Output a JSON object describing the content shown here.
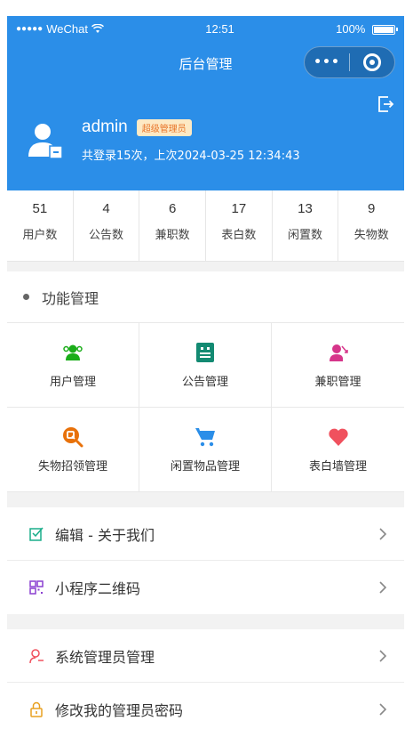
{
  "status_bar": {
    "carrier": "WeChat",
    "time": "12:51",
    "battery": "100%"
  },
  "nav": {
    "title": "后台管理",
    "more_icon": "more-dots-icon",
    "close_icon": "circle-target-icon"
  },
  "profile": {
    "username": "admin",
    "role": "超级管理员",
    "login_info": "共登录15次，上次2024-03-25 12:34:43"
  },
  "stats": [
    {
      "value": "51",
      "label": "用户数"
    },
    {
      "value": "4",
      "label": "公告数"
    },
    {
      "value": "6",
      "label": "兼职数"
    },
    {
      "value": "17",
      "label": "表白数"
    },
    {
      "value": "13",
      "label": "闲置数"
    },
    {
      "value": "9",
      "label": "失物数"
    }
  ],
  "functions": {
    "title": "功能管理",
    "items": [
      {
        "label": "用户管理",
        "icon": "users-icon",
        "color": "#1aad19"
      },
      {
        "label": "公告管理",
        "icon": "notice-icon",
        "color": "#138a72"
      },
      {
        "label": "兼职管理",
        "icon": "part-time-icon",
        "color": "#d6358a"
      },
      {
        "label": "失物招领管理",
        "icon": "lost-found-icon",
        "color": "#e8710a"
      },
      {
        "label": "闲置物品管理",
        "icon": "cart-icon",
        "color": "#2b8ee8"
      },
      {
        "label": "表白墙管理",
        "icon": "heart-icon",
        "color": "#f0515e"
      }
    ]
  },
  "list1": [
    {
      "label": "编辑 - 关于我们",
      "icon": "edit-icon",
      "color": "#1aad8a"
    },
    {
      "label": "小程序二维码",
      "icon": "qrcode-icon",
      "color": "#8a3fd1"
    }
  ],
  "list2": [
    {
      "label": "系统管理员管理",
      "icon": "admin-user-icon",
      "color": "#f0515e"
    },
    {
      "label": "修改我的管理员密码",
      "icon": "lock-icon",
      "color": "#e8a020"
    }
  ]
}
